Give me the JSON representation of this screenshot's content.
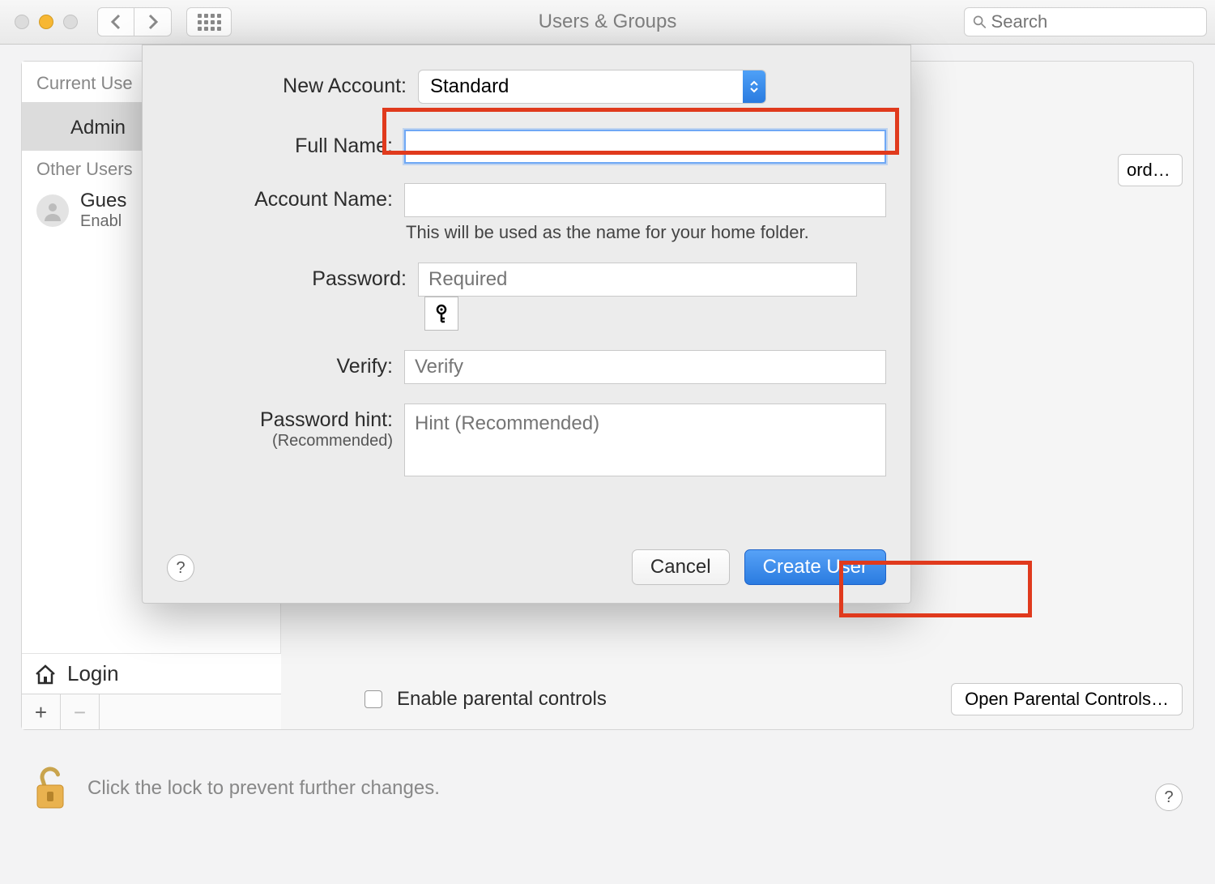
{
  "window": {
    "title": "Users & Groups",
    "search_placeholder": "Search"
  },
  "sidebar": {
    "current_user_header": "Current Use",
    "current_user_role": "Admin",
    "other_users_header": "Other Users",
    "guest": {
      "name": "Gues",
      "status": "Enabl"
    },
    "login_options": "Login",
    "add": "+",
    "remove": "−"
  },
  "right_panel": {
    "peek_button": "ord…",
    "parental_checkbox_label": "Enable parental controls",
    "open_parental_button": "Open Parental Controls…"
  },
  "lock": {
    "text": "Click the lock to prevent further changes."
  },
  "sheet": {
    "new_account_label": "New Account:",
    "new_account_value": "Standard",
    "full_name_label": "Full Name:",
    "full_name_value": "",
    "account_name_label": "Account Name:",
    "account_name_value": "",
    "account_name_hint": "This will be used as the name for your home folder.",
    "password_label": "Password:",
    "password_placeholder": "Required",
    "verify_label": "Verify:",
    "verify_placeholder": "Verify",
    "hint_label": "Password hint:",
    "hint_sublabel": "(Recommended)",
    "hint_placeholder": "Hint (Recommended)",
    "cancel": "Cancel",
    "create": "Create User",
    "help": "?"
  },
  "help_symbol": "?"
}
